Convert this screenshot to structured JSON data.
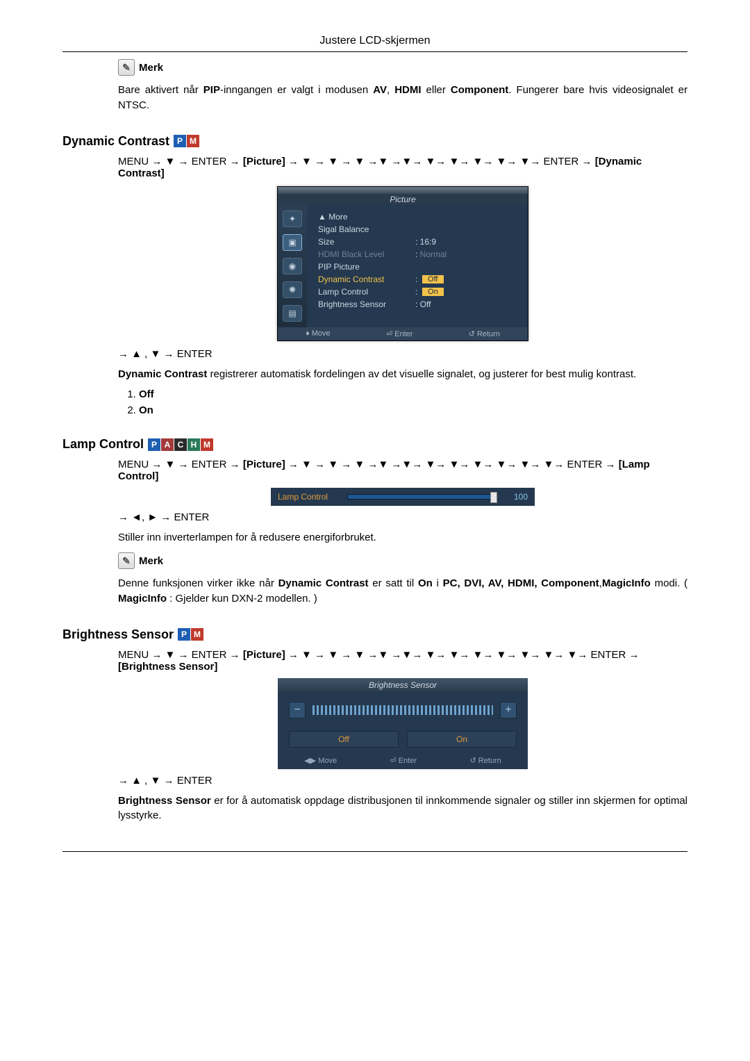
{
  "header": {
    "title": "Justere LCD-skjermen"
  },
  "merk_label": "Merk",
  "note1": {
    "text_a": "Bare aktivert når ",
    "pip": "PIP",
    "text_b": "-inngangen er valgt i modusen ",
    "av": "AV",
    "hdmi": "HDMI",
    "eller": " eller ",
    "comp": "Component",
    "text_c": ". Fungerer bare hvis videosignalet er NTSC."
  },
  "dynamic": {
    "heading": "Dynamic Contrast",
    "nav": {
      "menu": "MENU → ▼ → ENTER → ",
      "picture": "[Picture]",
      "arrows": " → ▼ → ▼ → ▼ →▼ →▼→ ▼→ ▼→ ▼→ ▼→ ▼→ ENTER → ",
      "target": "[Dynamic Contrast]"
    },
    "nav2": "→ ▲ , ▼ → ENTER",
    "desc_a": "Dynamic Contrast",
    "desc_b": "  registrerer automatisk fordelingen av det visuelle signalet, og justerer for best mulig kontrast.",
    "opts": [
      "Off",
      "On"
    ]
  },
  "osd": {
    "title": "Picture",
    "more": "▲ More",
    "rows": [
      {
        "label": "Sigal Balance",
        "val": ""
      },
      {
        "label": "Size",
        "val": "16:9"
      },
      {
        "label": "HDMI Black Level",
        "val": "Normal",
        "dim": true
      },
      {
        "label": "PIP Picture",
        "val": ""
      },
      {
        "label": "Dynamic Contrast",
        "val": "Off",
        "highlight": true
      },
      {
        "label": "Lamp Control",
        "val": "On",
        "valhl": true
      },
      {
        "label": "Brightness Sensor",
        "val": "Off"
      }
    ],
    "foot": {
      "move": "Move",
      "enter": "Enter",
      "ret": "Return"
    }
  },
  "lamp": {
    "heading": "Lamp Control",
    "nav": {
      "menu": "MENU → ▼ → ENTER → ",
      "picture": "[Picture]",
      "arrows": " → ▼ → ▼ → ▼ →▼ →▼→ ▼→ ▼→ ▼→ ▼→ ▼→ ▼→ ENTER → ",
      "target": "[Lamp Control]"
    },
    "nav2": "→ ◄, ► → ENTER",
    "slider": {
      "label": "Lamp Control",
      "value": "100"
    },
    "desc": "Stiller inn inverterlampen for å redusere energiforbruket.",
    "note_a": "Denne funksjonen virker ikke når ",
    "note_dc": "Dynamic Contrast",
    "note_b": " er satt til ",
    "note_on": "On",
    "note_c": " i ",
    "note_modes": "PC, DVI, AV, HDMI, Component",
    "note_d": ",",
    "note_mi": "MagicInfo",
    "note_e": " modi. ( ",
    "note_mi2": "MagicInfo",
    "note_f": " : Gjelder kun DXN-2 modellen. )"
  },
  "bs": {
    "heading": "Brightness Sensor",
    "nav": {
      "menu": "MENU → ▼ → ENTER → ",
      "picture": "[Picture]",
      "arrows": " → ▼ → ▼ → ▼ →▼ →▼→ ▼→ ▼→ ▼→ ▼→ ▼→ ▼→ ▼→ ENTER → ",
      "target": "[Brightness Sensor]"
    },
    "nav2": "→ ▲ , ▼ → ENTER",
    "osd": {
      "title": "Brightness Sensor",
      "off": "Off",
      "on": "On",
      "minus": "−",
      "plus": "+",
      "move": "Move",
      "enter": "Enter",
      "ret": "Return"
    },
    "desc_a": "Brightness Sensor",
    "desc_b": " er for å automatisk oppdage distribusjonen til innkommende signaler og stiller inn skjermen for optimal lysstyrke."
  }
}
